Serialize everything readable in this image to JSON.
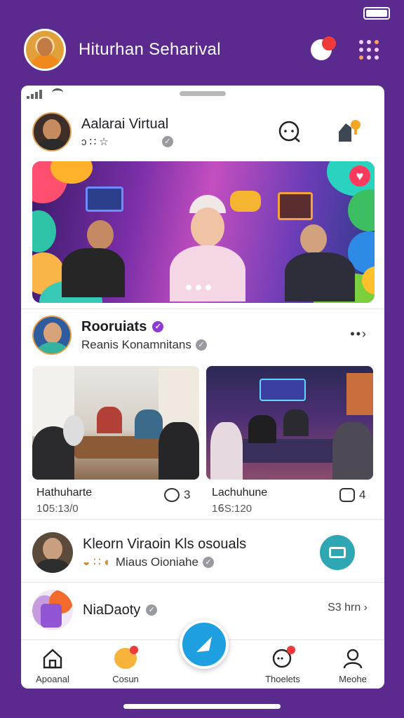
{
  "header": {
    "title": "Hiturhan Seharival"
  },
  "post1": {
    "name": "Aalarai Virtual",
    "sub_icons": "ɔ ∷ ☆"
  },
  "post2": {
    "name": "Rooruiats",
    "sub": "Reanis Konamnitans"
  },
  "photos": [
    {
      "caption": "Hathuharte",
      "meta": "1𝟢5:13/0",
      "comments": "3"
    },
    {
      "caption": "Lachuhune",
      "meta": "1𝟨S:120",
      "comments": "4"
    }
  ],
  "post3": {
    "name": "Kleorn Viraoin Kls osouals",
    "sub": "Miaus Oioniahe"
  },
  "post4": {
    "name": "NiaDaoty",
    "time": "S3 hrn"
  },
  "tabs": [
    {
      "label": "Apoanal"
    },
    {
      "label": "Cosun"
    },
    {
      "label": "Thoelets"
    },
    {
      "label": "Meohe"
    }
  ],
  "colors": {
    "background": "#5a2a8e",
    "accent": "#1e9fe0",
    "verified_purple": "#8d3bd6"
  }
}
